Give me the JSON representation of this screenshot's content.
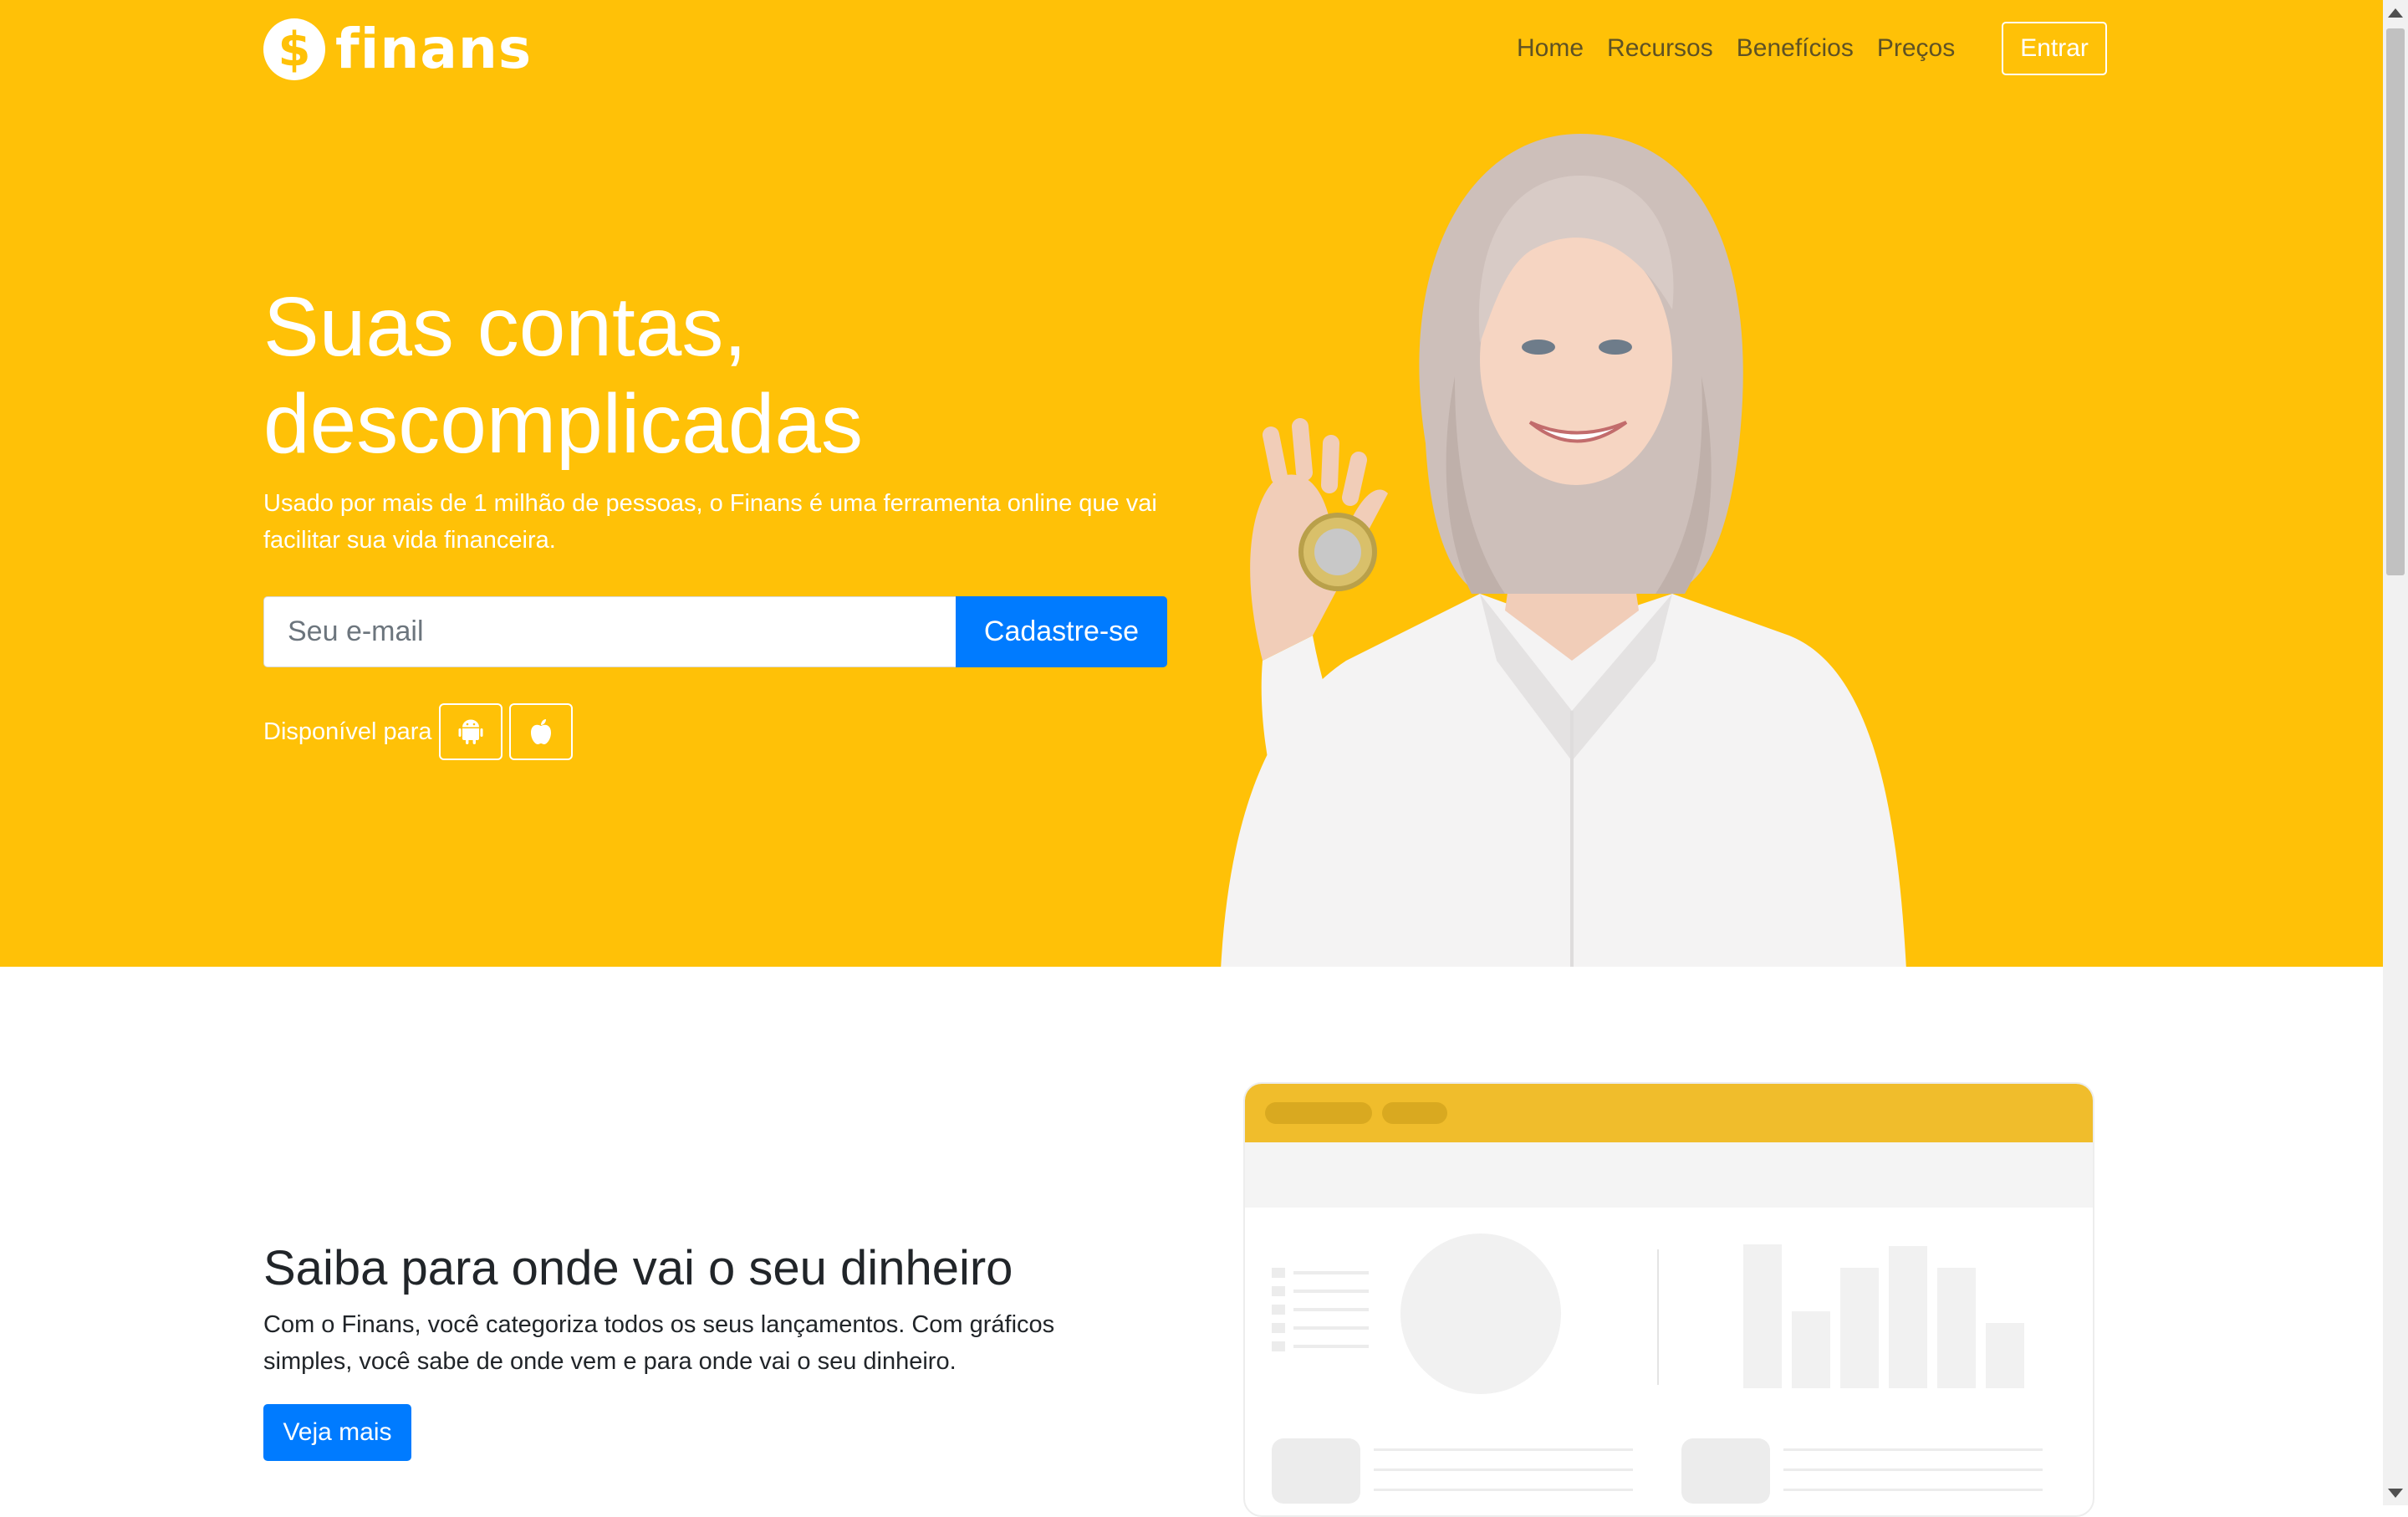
{
  "brand": {
    "name": "finans",
    "coin_symbol": "$",
    "accent": "#ffc107"
  },
  "nav": {
    "links": [
      "Home",
      "Recursos",
      "Benefícios",
      "Preços"
    ],
    "login_label": "Entrar"
  },
  "hero": {
    "headline_line1": "Suas contas,",
    "headline_line2": "descomplicadas",
    "subtitle": "Usado por mais de 1 milhão de pessoas, o Finans é uma ferramenta online que vai facilitar sua vida financeira.",
    "email_placeholder": "Seu e-mail",
    "signup_label": "Cadastre-se",
    "available_label": "Disponível para",
    "stores": [
      "android-icon",
      "apple-icon"
    ]
  },
  "feature": {
    "title": "Saiba para onde vai o seu dinheiro",
    "text": "Com o Finans, você categoriza todos os seus lançamentos. Com gráficos simples, você sabe de onde vem e para onde vai o seu dinheiro.",
    "button_label": "Veja mais"
  },
  "colors": {
    "hero_bg": "#ffc107",
    "primary_button": "#007bff",
    "mock_header": "#f0bd2c"
  }
}
